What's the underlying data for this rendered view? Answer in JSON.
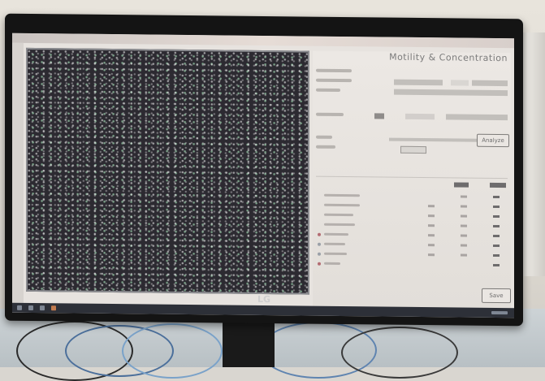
{
  "scene": {
    "description_domain": "photo of a monitor showing a microscopy analysis application"
  },
  "app": {
    "panel_title": "Motility & Concentration",
    "button_top": "Analyze",
    "button_bottom": "Save"
  },
  "monitor": {
    "brand": "LG"
  },
  "colors": {
    "image_background": "#2c2a31",
    "particle_white": "#ffffff",
    "particle_green": "#b9ffcd",
    "panel": "#e7e3df",
    "bezel": "#141414"
  },
  "icons": [
    "particle-image",
    "taskbar-icon"
  ]
}
